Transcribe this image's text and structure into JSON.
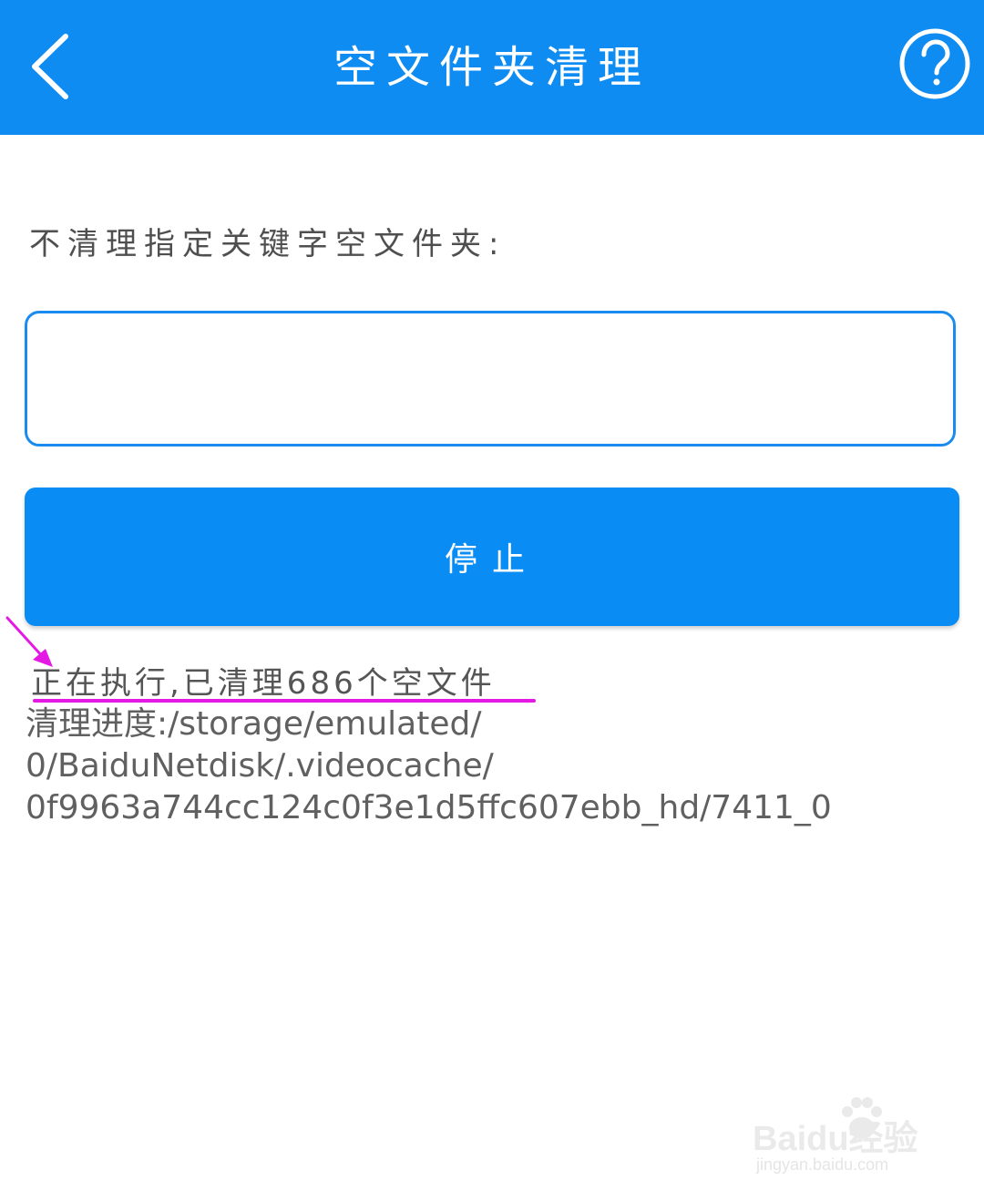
{
  "app_bar": {
    "title": "空文件夹清理",
    "back_icon": "chevron-left-icon",
    "help_icon": "question-circle-icon",
    "color": "#0f8cf2"
  },
  "form": {
    "label": "不清理指定关键字空文件夹:",
    "keyword_input": {
      "value": "",
      "placeholder": ""
    },
    "stop_button_label": "停止"
  },
  "status": {
    "message": "正在执行,已清理686个空文件",
    "progress_text": "清理进度:/storage/emulated/\n0/BaiduNetdisk/.videocache/\n0f9963a744cc124c0f3e1d5ffc607ebb_hd/7411_0"
  },
  "annotation": {
    "color": "#e41ae4",
    "arrow_icon": "arrow-pointer-icon"
  },
  "watermark": {
    "brand": "Baidu经验",
    "url": "jingyan.baidu.com"
  }
}
